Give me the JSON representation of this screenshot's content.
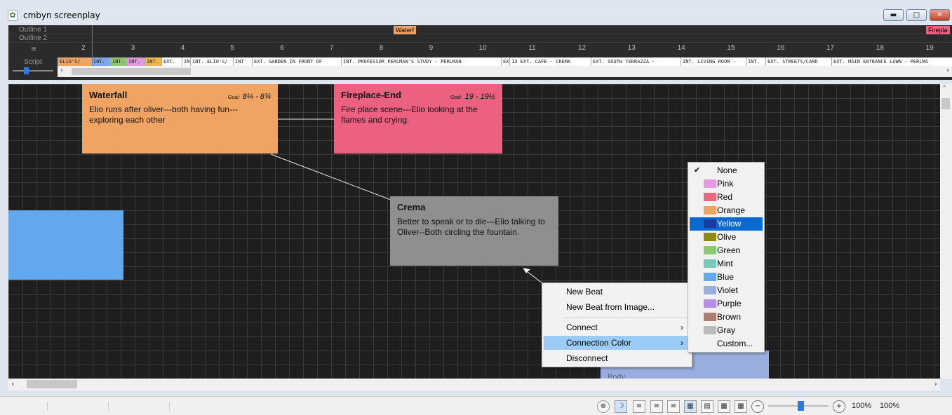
{
  "window": {
    "title": "cmbyn screenplay"
  },
  "outline": {
    "row1_label": "Outline 1",
    "row2_label": "Outline 2",
    "script_label": "Script",
    "tags": [
      {
        "label": "Waterf",
        "color": "#f0a463"
      },
      {
        "label": "Firepla",
        "color": "#ec6080"
      }
    ],
    "ruler_ticks": [
      "2",
      "3",
      "4",
      "5",
      "6",
      "7",
      "8",
      "9",
      "10",
      "11",
      "12",
      "13",
      "14",
      "15",
      "16",
      "17",
      "18",
      "19"
    ],
    "scenes": [
      {
        "label": "ELIO'S/",
        "color": "#f0a463"
      },
      {
        "label": "INT.",
        "color": "#7ea8e8"
      },
      {
        "label": "INT.",
        "color": "#8cc870"
      },
      {
        "label": "INT.",
        "color": "#e09ae0"
      },
      {
        "label": "INT.",
        "color": "#f0b848"
      },
      {
        "label": "EXT.",
        "color": "#ffffff"
      },
      {
        "label": "IN",
        "color": "#ffffff"
      },
      {
        "label": "INT. ELIO'S/",
        "color": "#ffffff"
      },
      {
        "label": "INT",
        "color": "#ffffff"
      },
      {
        "label": "EXT. GARDEN IN FRONT OF",
        "color": "#ffffff"
      },
      {
        "label": "INT. PROFESSOR PERLMAN'S STUDY - PERLMAN",
        "color": "#ffffff"
      },
      {
        "label": "EX",
        "color": "#ffffff"
      },
      {
        "label": "13 EXT. CAFE - CREMA",
        "color": "#ffffff"
      },
      {
        "label": "EXT. SOUTH TERRAZZA -",
        "color": "#ffffff"
      },
      {
        "label": "INT. LIVING ROOM -",
        "color": "#ffffff"
      },
      {
        "label": "INT.",
        "color": "#ffffff"
      },
      {
        "label": "EXT. STREETS/CARD",
        "color": "#ffffff"
      },
      {
        "label": "EXT. MAIN ENTRANCE LAWN - PERLMA",
        "color": "#ffffff"
      }
    ]
  },
  "cards": [
    {
      "title": "Waterfall",
      "goal_label": "Goal:",
      "goal": "8¼ - 8¾",
      "body": "Elio runs after oliver---both having fun---exploring each other",
      "color": "#f0a463"
    },
    {
      "title": "Fireplace-End",
      "goal_label": "Goal:",
      "goal": "19 - 19½",
      "body": "Fire place scene---Elio looking at the flames and crying.",
      "color": "#ec6080"
    },
    {
      "title": "Crema",
      "body": "Better to speak or to die---Elio talking to Oliver--Both circling the fountain.",
      "color": "#8f8f8f"
    },
    {
      "title": "",
      "body": "",
      "color": "#62a8ee"
    },
    {
      "title": "",
      "body": "Body",
      "color": "#9aaede"
    }
  ],
  "context_menu": {
    "items": [
      {
        "label": "New Beat"
      },
      {
        "label": "New Beat from Image..."
      },
      {
        "label": "Connect"
      },
      {
        "label": "Connection Color"
      },
      {
        "label": "Disconnect"
      }
    ]
  },
  "color_submenu": {
    "items": [
      {
        "label": "None",
        "color": "",
        "checked": true
      },
      {
        "label": "Pink",
        "color": "#e59ae0"
      },
      {
        "label": "Red",
        "color": "#e86a80"
      },
      {
        "label": "Orange",
        "color": "#f0a463"
      },
      {
        "label": "Yellow",
        "color": "#1c3aa0"
      },
      {
        "label": "Olive",
        "color": "#8c8c10"
      },
      {
        "label": "Green",
        "color": "#8cc870"
      },
      {
        "label": "Mint",
        "color": "#7cc8b8"
      },
      {
        "label": "Blue",
        "color": "#62a8ee"
      },
      {
        "label": "Violet",
        "color": "#9aaede"
      },
      {
        "label": "Purple",
        "color": "#b48ee8"
      },
      {
        "label": "Brown",
        "color": "#b07e70"
      },
      {
        "label": "Gray",
        "color": "#bcbcbc"
      },
      {
        "label": "Custom...",
        "color": ""
      }
    ]
  },
  "statusbar": {
    "zoom_primary": "100%",
    "zoom_secondary": "100%",
    "zoom_level": 0.55
  }
}
